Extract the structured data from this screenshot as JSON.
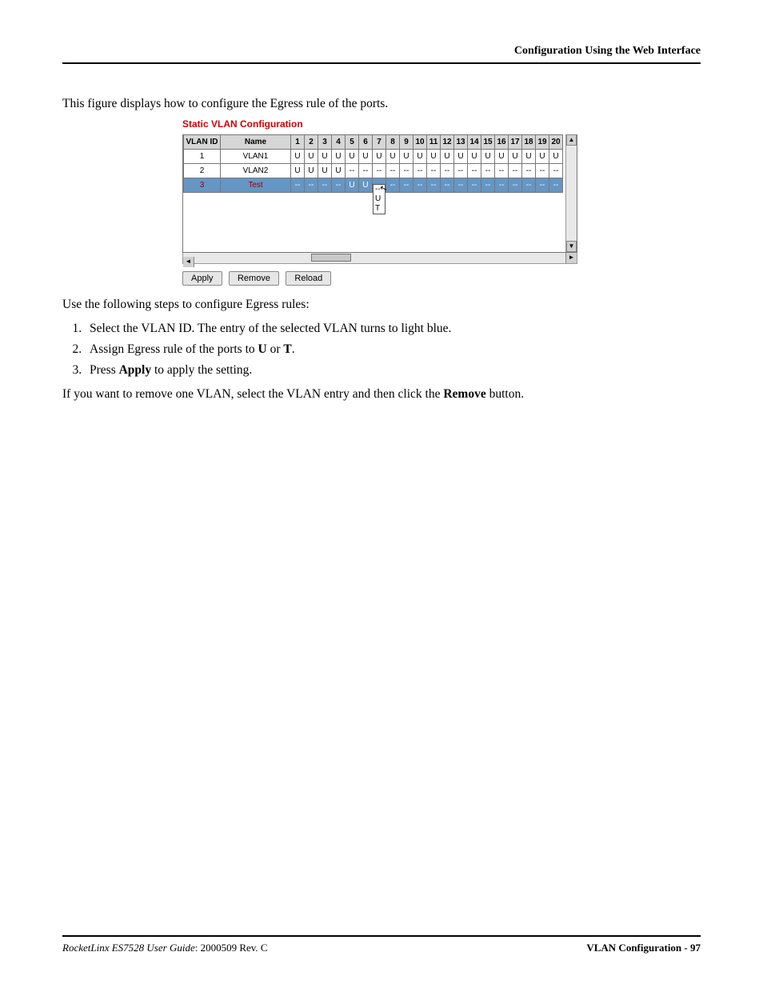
{
  "header": {
    "title": "Configuration Using the Web Interface"
  },
  "intro": "This figure displays how to configure the Egress rule of the ports.",
  "figure": {
    "title": "Static VLAN Configuration",
    "columns": {
      "id": "VLAN ID",
      "name": "Name"
    },
    "port_headers": [
      "1",
      "2",
      "3",
      "4",
      "5",
      "6",
      "7",
      "8",
      "9",
      "10",
      "11",
      "12",
      "13",
      "14",
      "15",
      "16",
      "17",
      "18",
      "19",
      "20"
    ],
    "rows": [
      {
        "id": "1",
        "name": "VLAN1",
        "ports": [
          "U",
          "U",
          "U",
          "U",
          "U",
          "U",
          "U",
          "U",
          "U",
          "U",
          "U",
          "U",
          "U",
          "U",
          "U",
          "U",
          "U",
          "U",
          "U",
          "U"
        ],
        "selected": false
      },
      {
        "id": "2",
        "name": "VLAN2",
        "ports": [
          "U",
          "U",
          "U",
          "U",
          "--",
          "--",
          "--",
          "--",
          "--",
          "--",
          "--",
          "--",
          "--",
          "--",
          "--",
          "--",
          "--",
          "--",
          "--",
          "--"
        ],
        "selected": false
      },
      {
        "id": "3",
        "name": "Test",
        "ports": [
          "--",
          "--",
          "--",
          "--",
          "U",
          "U",
          "",
          "--",
          "--",
          "--",
          "--",
          "--",
          "--",
          "--",
          "--",
          "--",
          "--",
          "--",
          "--",
          "--"
        ],
        "selected": true
      }
    ],
    "dropdown_options": [
      "--",
      "U",
      "T"
    ],
    "buttons": {
      "apply": "Apply",
      "remove": "Remove",
      "reload": "Reload"
    }
  },
  "steps_intro": "Use the following steps to configure Egress rules:",
  "steps": [
    "Select the VLAN ID. The entry of the selected VLAN turns to light blue.",
    "Assign Egress rule of the ports to <b>U</b> or <b>T</b>.",
    "Press <b>Apply</b> to apply the setting."
  ],
  "note": "If you want to remove one VLAN, select the VLAN entry and then click the <b>Remove</b> button.",
  "footer": {
    "left_italic": "RocketLinx ES7528  User Guide",
    "left_rest": ": 2000509 Rev. C",
    "right": "VLAN Configuration - 97"
  }
}
